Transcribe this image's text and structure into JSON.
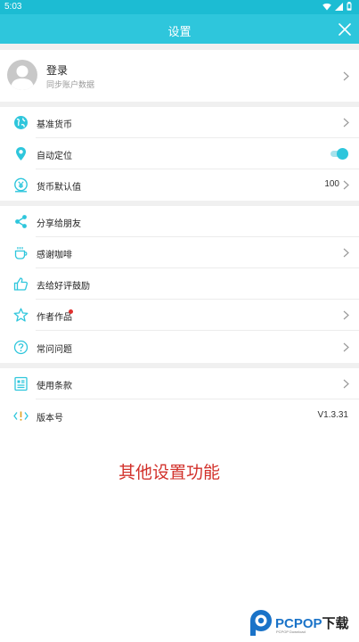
{
  "status_bar": {
    "time": "5:03",
    "icons": [
      "wifi-icon",
      "signal-icon",
      "battery-icon"
    ]
  },
  "app_bar": {
    "title": "设置",
    "close_icon": "close-icon"
  },
  "login": {
    "title": "登录",
    "subtitle": "同步账户数据"
  },
  "rows": [
    {
      "label": "基准货币",
      "icon": "globe-icon"
    },
    {
      "label": "自动定位",
      "icon": "location-pin-icon",
      "toggle_on": true
    },
    {
      "label": "货币默认值",
      "icon": "yen-coin-icon",
      "value": "100"
    },
    {
      "label": "分享给朋友",
      "icon": "share-icon"
    },
    {
      "label": "感谢咖啡",
      "icon": "coffee-cup-icon"
    },
    {
      "label": "去给好评鼓励",
      "icon": "thumbs-up-icon"
    },
    {
      "label": "作者作品",
      "icon": "star-icon",
      "has_badge": true
    },
    {
      "label": "常问问题",
      "icon": "question-icon"
    },
    {
      "label": "使用条款",
      "icon": "document-icon"
    },
    {
      "label": "版本号",
      "icon": "code-info-icon",
      "value": "V1.3.31"
    }
  ],
  "caption": "其他设置功能",
  "watermark": {
    "brand": "PCPOP",
    "brand_suffix": "下载",
    "tagline": "PCPOP Download"
  },
  "colors": {
    "accent": "#2ec6dc",
    "statusbar": "#1cbcd3",
    "caption": "#d2312b",
    "badge": "#e0302e"
  }
}
